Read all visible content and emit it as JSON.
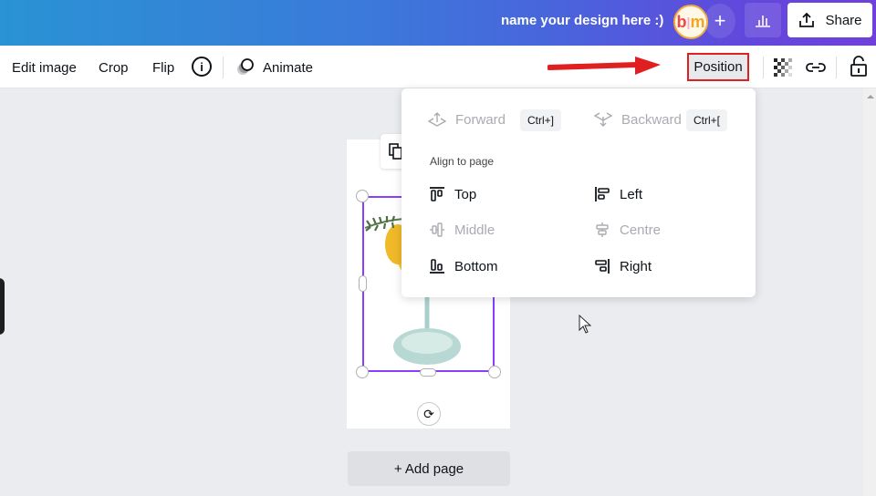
{
  "topbar": {
    "design_name": "name your design here :)",
    "avatar": {
      "left": "b",
      "sep": "|",
      "right": "m"
    },
    "plus_label": "+",
    "share_label": "Share",
    "gradient_start": "#2a93d4",
    "gradient_end": "#7040dc"
  },
  "toolbar": {
    "edit_image": "Edit image",
    "crop": "Crop",
    "flip": "Flip",
    "info": "i",
    "animate": "Animate",
    "position": "Position",
    "highlight_color": "#e02020"
  },
  "position_menu": {
    "forward": {
      "label": "Forward",
      "shortcut": "Ctrl+]",
      "enabled": false
    },
    "backward": {
      "label": "Backward",
      "shortcut": "Ctrl+[",
      "enabled": false
    },
    "heading": "Align to page",
    "align": [
      {
        "label": "Top",
        "enabled": true
      },
      {
        "label": "Left",
        "enabled": true
      },
      {
        "label": "Middle",
        "enabled": false
      },
      {
        "label": "Centre",
        "enabled": false
      },
      {
        "label": "Bottom",
        "enabled": true
      },
      {
        "label": "Right",
        "enabled": true
      }
    ]
  },
  "canvas": {
    "add_page": "+ Add page",
    "selection_color": "#8b3dff",
    "rotate_icon": "⟳"
  }
}
